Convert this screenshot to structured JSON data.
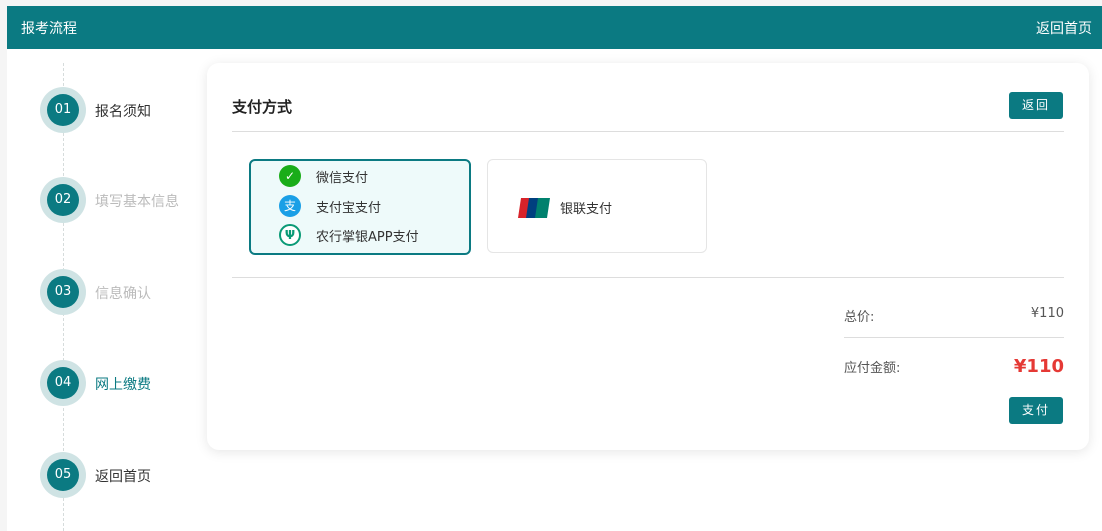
{
  "header": {
    "title": "报考流程",
    "back_link": "返回首页"
  },
  "steps": [
    {
      "num": "01",
      "label": "报名须知",
      "state": "done"
    },
    {
      "num": "02",
      "label": "填写基本信息",
      "state": "todo"
    },
    {
      "num": "03",
      "label": "信息确认",
      "state": "todo"
    },
    {
      "num": "04",
      "label": "网上缴费",
      "state": "active"
    },
    {
      "num": "05",
      "label": "返回首页",
      "state": "done"
    }
  ],
  "card": {
    "title": "支付方式",
    "back_button": "返回",
    "selected_group": [
      {
        "icon": "wechat-pay-icon",
        "label": "微信支付"
      },
      {
        "icon": "alipay-icon",
        "label": "支付宝支付"
      },
      {
        "icon": "abc-bank-icon",
        "label": "农行掌银APP支付"
      }
    ],
    "unionpay": {
      "icon": "unionpay-icon",
      "label": "银联支付"
    },
    "total_label": "总价:",
    "total_value": "¥110",
    "due_label": "应付金额:",
    "due_value": "¥110",
    "pay_button": "支付"
  },
  "colors": {
    "primary": "#0b7a82",
    "price": "#e53935",
    "wechat": "#1aad19",
    "alipay": "#1a9fe6",
    "abc": "#0a9a76"
  }
}
